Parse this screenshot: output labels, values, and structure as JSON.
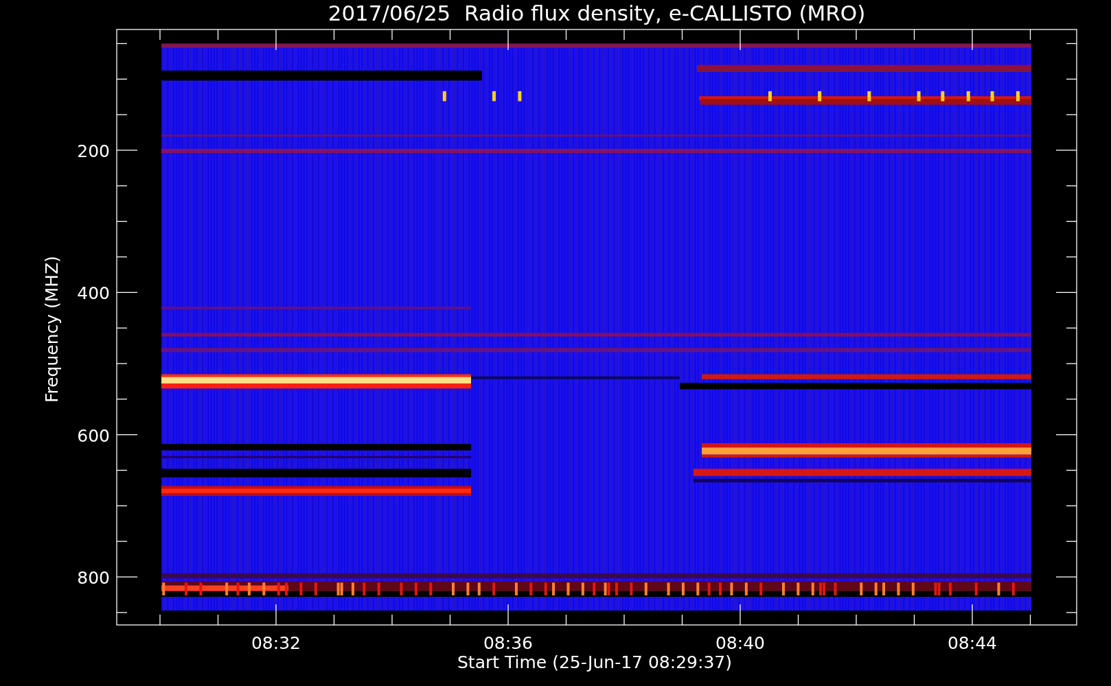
{
  "chart": {
    "title": "2017/06/25  Radio flux density, e-CALLISTO (MRO)",
    "ylabel": "Frequency (MHZ)",
    "xlabel": "Start Time (25-Jun-17 08:29:37)",
    "yticks": [
      "200",
      "400",
      "600",
      "800"
    ],
    "xticks": [
      "08:32",
      "08:36",
      "08:40",
      "08:44"
    ]
  }
}
